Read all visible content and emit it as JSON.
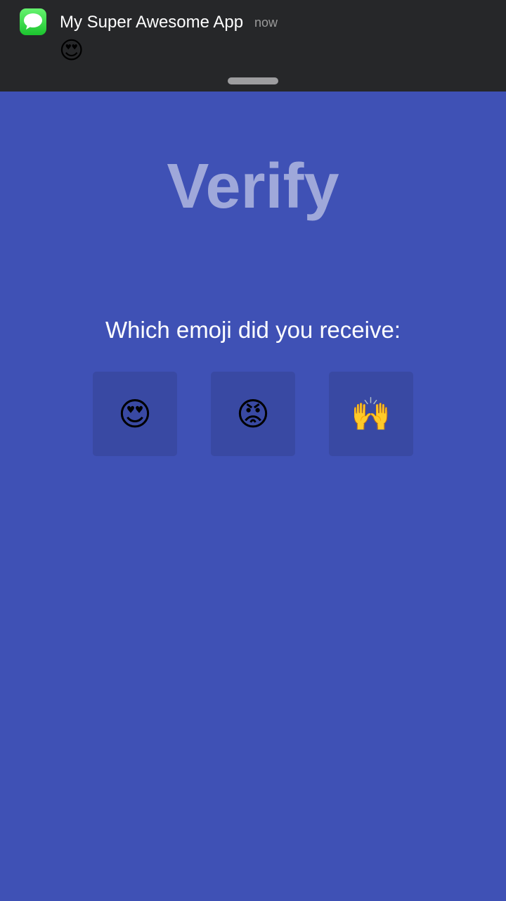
{
  "notification": {
    "app_icon": "messages-icon",
    "title": "My Super Awesome App",
    "time": "now",
    "body": "😍"
  },
  "page": {
    "title": "Verify",
    "prompt": "Which emoji did you receive:"
  },
  "choices": [
    {
      "emoji": "😍",
      "name": "heart-eyes"
    },
    {
      "emoji": "😡",
      "name": "angry-face"
    },
    {
      "emoji": "🙌",
      "name": "raised-hands"
    }
  ],
  "colors": {
    "background": "#3f51b5",
    "notification_bg": "#262729",
    "title": "#9fa8da",
    "tile": "#3949a3"
  }
}
